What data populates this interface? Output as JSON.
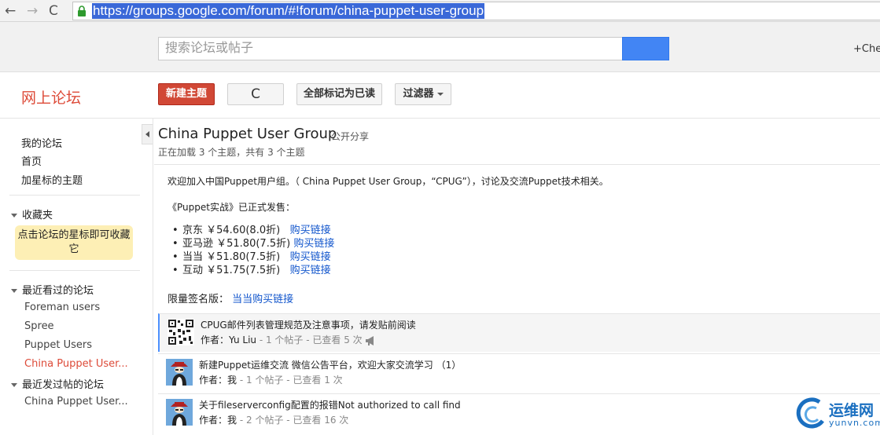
{
  "browser": {
    "back_glyph": "←",
    "forward_glyph": "→",
    "reload_glyph": "C",
    "url": "https://groups.google.com/forum/#!forum/china-puppet-user-group"
  },
  "google_bar": {
    "search_placeholder": "搜索论坛或帖子",
    "plus_user": "+Cher"
  },
  "toolbar": {
    "app_title": "网上论坛",
    "new_topic": "新建主题",
    "refresh_glyph": "C",
    "mark_all_read": "全部标记为已读",
    "filter": "过滤器"
  },
  "sidebar": {
    "links": [
      "我的论坛",
      "首页",
      "加星标的主题"
    ],
    "favorites_label": "收藏夹",
    "favorites_hint": "点击论坛的星标即可收藏它",
    "recent_viewed_label": "最近看过的论坛",
    "recent_viewed": [
      "Foreman users",
      "Spree",
      "Puppet Users",
      "China Puppet User..."
    ],
    "recent_posted_label": "最近发过帖的论坛",
    "recent_posted": [
      "China Puppet User..."
    ]
  },
  "group": {
    "title": "China Puppet User Group",
    "visibility": "公开分享",
    "loading": "正在加载 3 个主题，共有 3 个主题",
    "welcome": "欢迎加入中国Puppet用户组。（ China Puppet User Group，“CPUG”），讨论及交流Puppet技术相关。",
    "book_line": "《Puppet实战》已正式发售：",
    "purchase": [
      {
        "store": "京东 ￥54.60(8.0折)",
        "link": "购买链接"
      },
      {
        "store": "亚马逊 ￥51.80(7.5折)",
        "link": "购买链接"
      },
      {
        "store": "当当 ￥51.80(7.5折)",
        "link": "购买链接"
      },
      {
        "store": "互动 ￥51.75(7.5折)",
        "link": "购买链接"
      }
    ],
    "signed_label": "限量签名版：",
    "signed_link": "当当购买链接"
  },
  "topics": [
    {
      "title": "CPUG邮件列表管理规范及注意事项，请发贴前阅读",
      "author_label": "作者：",
      "author": "Yu Liu",
      "stats": " - 1 个帖子 - 已查看 5 次"
    },
    {
      "title": "新建Puppet运维交流 微信公告平台，欢迎大家交流学习 （1）",
      "author_label": "作者：",
      "author": "我",
      "stats": " - 1 个帖子 - 已查看 1 次"
    },
    {
      "title": "关于fileserverconfig配置的报错Not authorized to call find",
      "author_label": "作者：",
      "author": "我",
      "stats": " - 2 个帖子 - 已查看 16 次"
    }
  ],
  "watermark": {
    "name_cn": "运维网",
    "name_en": "yunvn.com"
  },
  "colors": {
    "accent_red": "#dd4b39",
    "google_blue": "#4285f4",
    "link_blue": "#1155cc",
    "favorites_bg": "#fdefb5"
  }
}
